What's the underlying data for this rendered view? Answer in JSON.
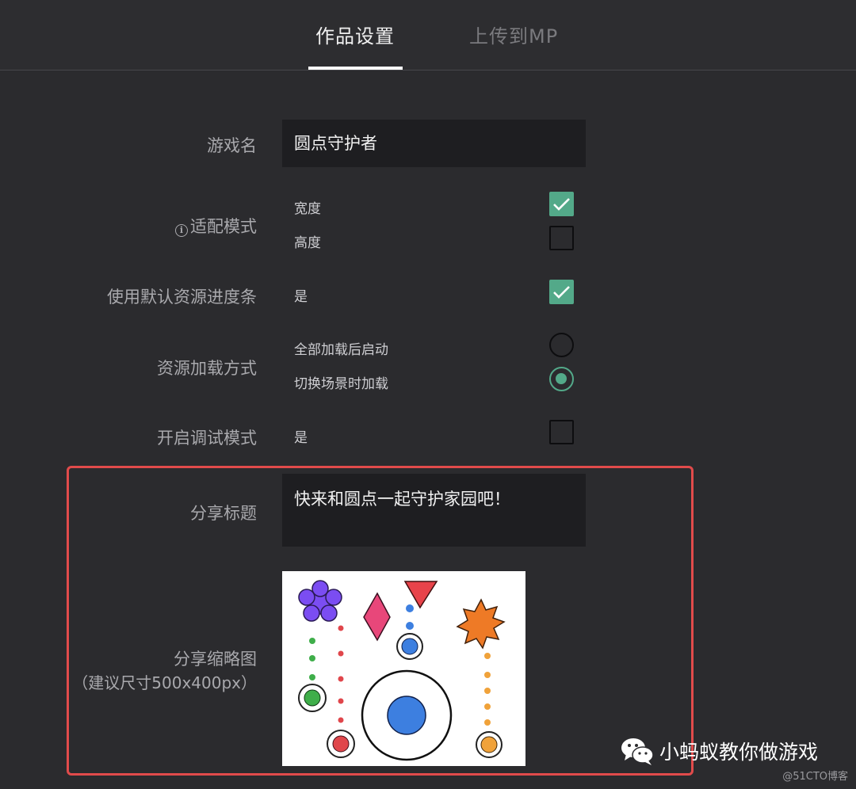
{
  "tabs": {
    "settings": "作品设置",
    "upload": "上传到MP"
  },
  "form": {
    "game_name": {
      "label": "游戏名",
      "value": "圆点守护者"
    },
    "fit_mode": {
      "label": "适配模式",
      "options": [
        {
          "label": "宽度",
          "checked": true
        },
        {
          "label": "高度",
          "checked": false
        }
      ]
    },
    "default_progress": {
      "label": "使用默认资源进度条",
      "option": "是",
      "checked": true
    },
    "load_mode": {
      "label": "资源加载方式",
      "options": [
        {
          "label": "全部加载后启动",
          "selected": false
        },
        {
          "label": "切换场景时加载",
          "selected": true
        }
      ]
    },
    "debug_mode": {
      "label": "开启调试模式",
      "option": "是",
      "checked": false
    },
    "share_title": {
      "label": "分享标题",
      "value": "快来和圆点一起守护家园吧！"
    },
    "share_thumb": {
      "label": "分享缩略图",
      "hint": "（建议尺寸500x400px）"
    }
  },
  "watermark": {
    "text": "小蚂蚁教你做游戏",
    "corner": "@51CTO博客"
  },
  "colors": {
    "accent": "#53a989",
    "highlight": "#e14b4b",
    "background": "#2b2b2e"
  }
}
